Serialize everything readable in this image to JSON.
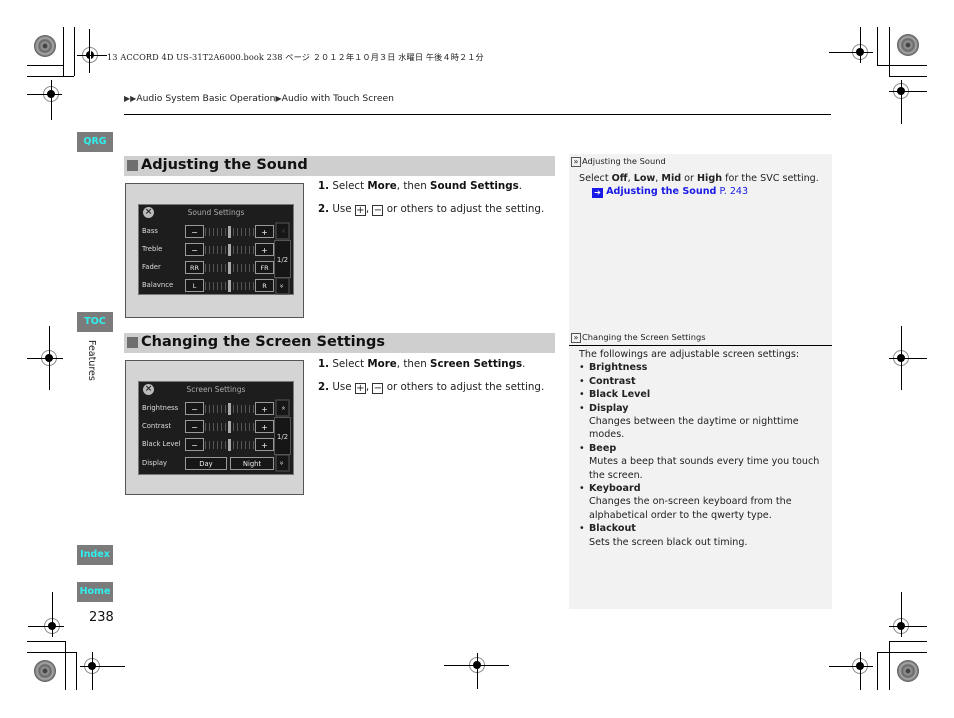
{
  "print_header": {
    "text": "13 ACCORD 4D US-31T2A6000.book  238 ページ  ２０１２年１０月３日  水曜日  午後４時２１分"
  },
  "breadcrumb": {
    "items": [
      "Audio System Basic Operation",
      "Audio with Touch Screen"
    ]
  },
  "side_tabs": {
    "qrg": "QRG",
    "toc": "TOC",
    "index": "Index",
    "home": "Home"
  },
  "chapter_label": "Features",
  "page_number": "238",
  "sections": [
    {
      "title": "Adjusting the Sound",
      "screen": {
        "title": "Sound Settings",
        "rows": [
          {
            "label": "Bass",
            "left": "−",
            "right": "+"
          },
          {
            "label": "Treble",
            "left": "−",
            "right": "+"
          },
          {
            "label": "Fader",
            "left": "RR",
            "right": "FR"
          },
          {
            "label": "Balavnce",
            "left": "L",
            "right": "R"
          }
        ],
        "page_indicator": "1/2",
        "up_arrow": "»",
        "down_arrow": "»"
      },
      "steps": [
        {
          "num": "1.",
          "pre": " Select ",
          "b1": "More",
          "mid": ", then ",
          "b2": "Sound Settings",
          "post": "."
        },
        {
          "num": "2.",
          "pre": " Use ",
          "plus": "+",
          "sep": ", ",
          "minus": "−",
          "post": " or others to adjust the setting."
        }
      ],
      "note": {
        "heading": "Adjusting the Sound",
        "text_pre": "Select ",
        "opt1": "Off",
        "c1": ", ",
        "opt2": "Low",
        "c2": ", ",
        "opt3": "Mid",
        "c3": " or ",
        "opt4": "High",
        "text_post": " for the SVC setting.",
        "link_title": "Adjusting the Sound",
        "link_page": " P. 243"
      }
    },
    {
      "title": "Changing the Screen Settings",
      "screen": {
        "title": "Screen Settings",
        "rows": [
          {
            "label": "Brightness",
            "left": "−",
            "right": "+"
          },
          {
            "label": "Contrast",
            "left": "−",
            "right": "+"
          },
          {
            "label": "Black Level",
            "left": "−",
            "right": "+"
          },
          {
            "label": "Display",
            "left": "Day",
            "right": "Night"
          }
        ],
        "page_indicator": "1/2",
        "up_arrow": "»",
        "down_arrow": "»"
      },
      "steps": [
        {
          "num": "1.",
          "pre": " Select ",
          "b1": "More",
          "mid": ", then ",
          "b2": "Screen Settings",
          "post": "."
        },
        {
          "num": "2.",
          "pre": " Use ",
          "plus": "+",
          "sep": ", ",
          "minus": "−",
          "post": " or others to adjust the setting."
        }
      ],
      "note": {
        "heading": "Changing the Screen Settings",
        "intro": "The followings are adjustable screen settings:",
        "items": [
          {
            "name": "Brightness",
            "desc": ""
          },
          {
            "name": "Contrast",
            "desc": ""
          },
          {
            "name": "Black Level",
            "desc": ""
          },
          {
            "name": "Display",
            "desc": "Changes between the daytime or nighttime modes."
          },
          {
            "name": "Beep",
            "desc": "Mutes a beep that sounds every time you touch the screen."
          },
          {
            "name": "Keyboard",
            "desc": "Changes the on-screen keyboard from the alphabetical order to the qwerty type."
          },
          {
            "name": "Blackout",
            "desc": "Sets the screen black out timing."
          }
        ]
      }
    }
  ],
  "colors": {
    "tab_bg": "#7b7b7b",
    "tab_text": "#2ff0ef",
    "section_bar": "#cfcfcf",
    "link": "#1a1ae6",
    "note_panel": "#f2f2f2"
  }
}
